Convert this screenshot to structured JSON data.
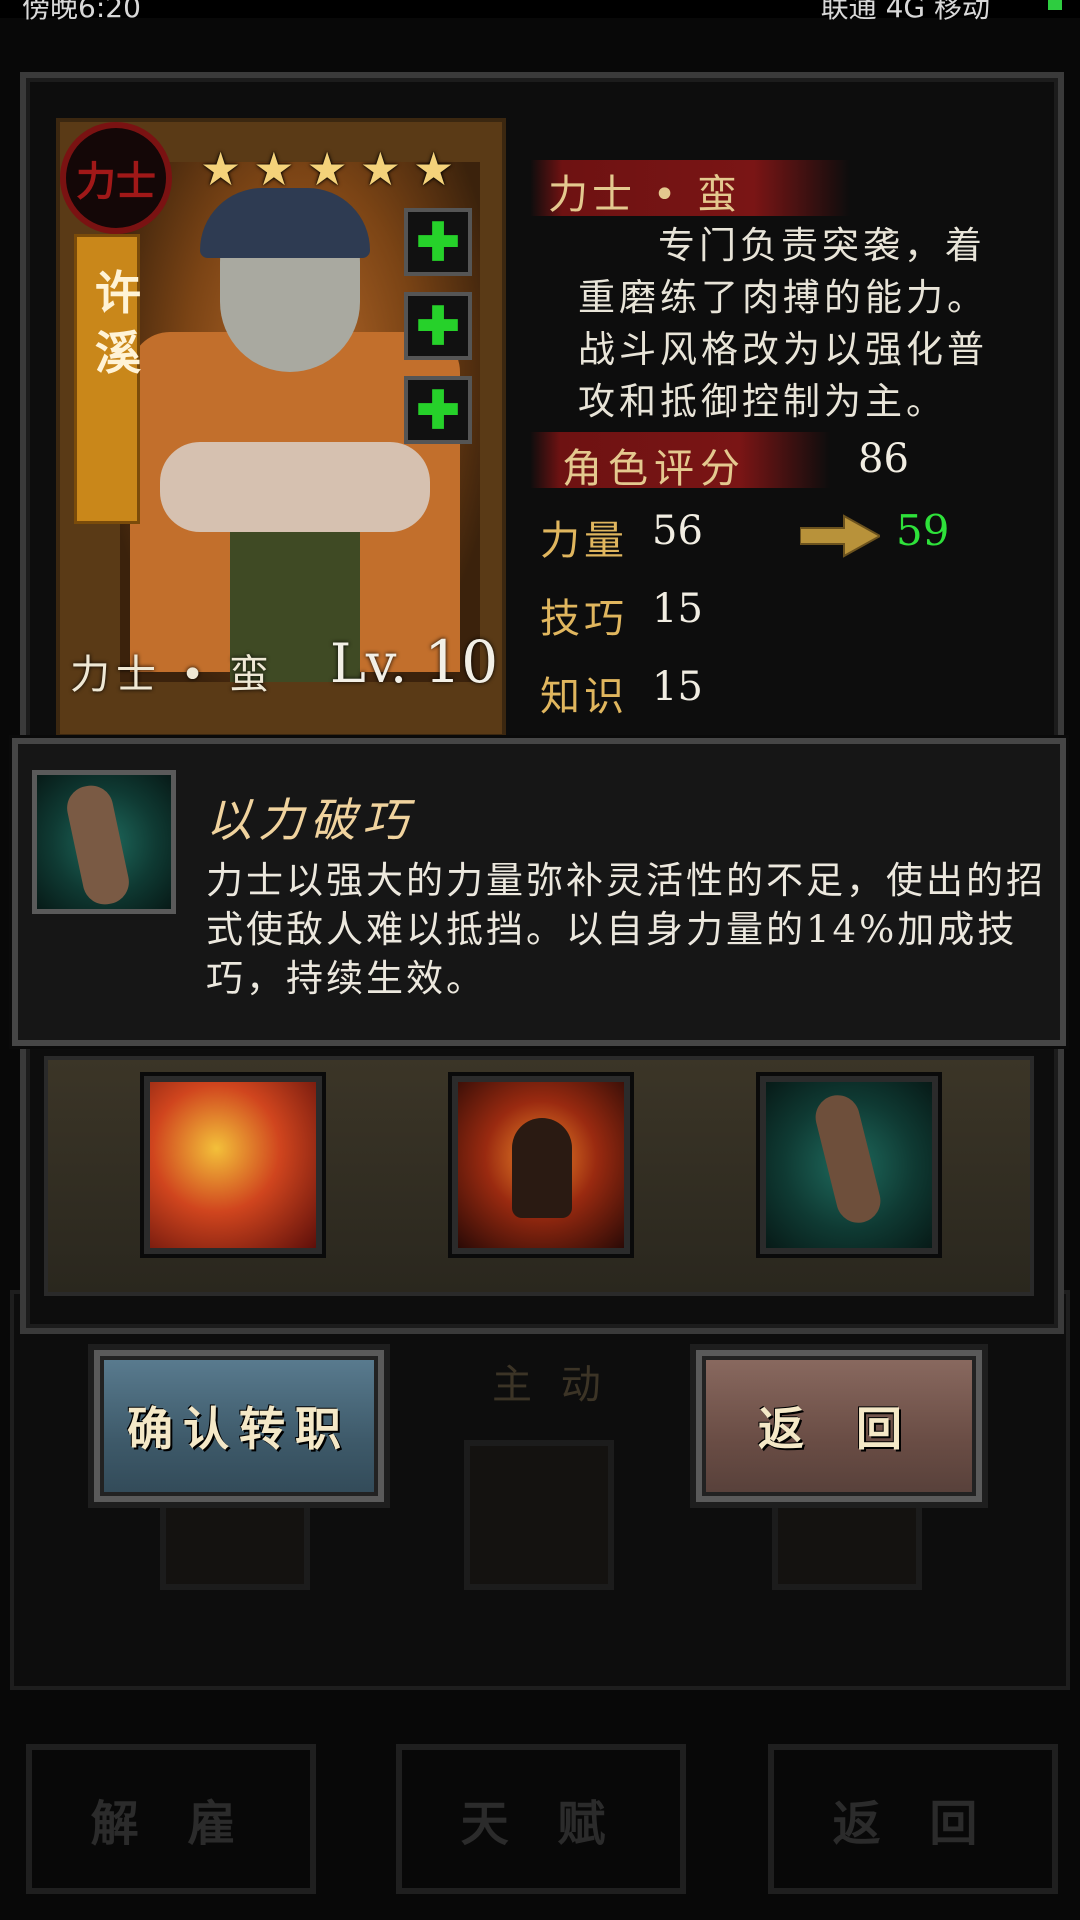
{
  "status_bar": {
    "time": "傍晚6:20",
    "network": "联通 4G  移动"
  },
  "card": {
    "badge_text": "力士",
    "hero_name_chars": [
      "许",
      "溪"
    ],
    "stars": 5,
    "class_name": "力士 • 蛮",
    "level_prefix": "Lv.",
    "level": "10",
    "plus_icons": [
      "plus-icon",
      "plus-icon",
      "plus-icon"
    ]
  },
  "info": {
    "class_title": "力士 • 蛮",
    "description": "专门负责突袭，着重磨练了肉搏的能力。战斗风格改为以强化普攻和抵御控制为主。",
    "rating_label": "角色评分",
    "rating_value": "86",
    "stats": [
      {
        "label": "力量",
        "value": "56",
        "new_value": "59"
      },
      {
        "label": "技巧",
        "value": "15"
      },
      {
        "label": "知识",
        "value": "15"
      }
    ]
  },
  "skill_popup": {
    "name": "以力破巧",
    "description": "力士以强大的力量弥补灵活性的不足，使出的招式使敌人难以抵挡。以自身力量的14%加成技巧，持续生效。"
  },
  "skills": [
    "fire-slash-icon",
    "rage-warrior-icon",
    "fist-icon"
  ],
  "buttons": {
    "confirm": "确认转职",
    "back": "返 回"
  },
  "background": {
    "active_label": "主 动",
    "bottom_buttons": [
      "解 雇",
      "天 赋",
      "返 回"
    ]
  },
  "colors": {
    "stat_up": "#2ee13a",
    "gold_text": "#e0b65e",
    "confirm_button": "#4a6a7c",
    "back_button": "#6e524a"
  }
}
